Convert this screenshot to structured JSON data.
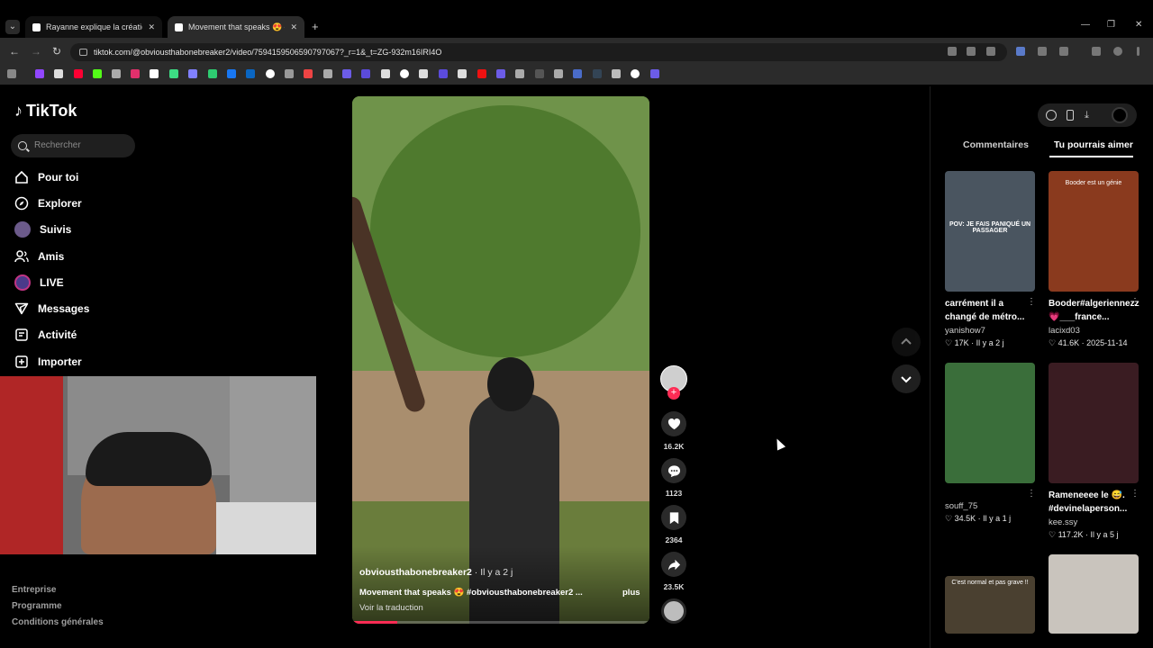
{
  "browser": {
    "tabs": [
      {
        "title": "Rayanne explique la création de",
        "active": false
      },
      {
        "title": "Movement that speaks 😍 #obvi",
        "active": true
      }
    ],
    "url": "tiktok.com/@obviousthabonebreaker2/video/7594159506590797067?_r=1&_t=ZG-932m16IRI4O"
  },
  "sidebar": {
    "brand": "TikTok",
    "search_placeholder": "Rechercher",
    "nav": [
      {
        "label": "Pour toi",
        "icon": "home-icon"
      },
      {
        "label": "Explorer",
        "icon": "compass-icon"
      },
      {
        "label": "Suivis",
        "icon": "following-avatar-icon"
      },
      {
        "label": "Amis",
        "icon": "friends-icon"
      },
      {
        "label": "LIVE",
        "icon": "live-icon"
      },
      {
        "label": "Messages",
        "icon": "messages-icon"
      },
      {
        "label": "Activité",
        "icon": "activity-icon"
      },
      {
        "label": "Importer",
        "icon": "upload-icon"
      }
    ],
    "footer_links": [
      "Entreprise",
      "Programme",
      "Conditions générales"
    ]
  },
  "video": {
    "author": "obviousthabonebreaker2",
    "posted": " · Il y a 2 j",
    "caption": "Movement that speaks 😍 #obviousthabonebreaker2 ...",
    "more": "plus",
    "translate": "Voir la traduction",
    "progress_percent": 15,
    "likes": "16.2K",
    "comments": "1123",
    "saves": "2364",
    "shares": "23.5K"
  },
  "right_panel": {
    "tabs": [
      "Commentaires",
      "Tu pourrais aimer"
    ],
    "active_tab": "Tu pourrais aimer",
    "cards": [
      {
        "overlay": "POV: JE FAIS PANIQUÉ UN PASSAGER",
        "title": "carrément il a changé de métro...",
        "author": "yanishow7",
        "likes": "17K",
        "date": "Il y a 2 j",
        "color": "#4a5560"
      },
      {
        "overlay": "Booder est un génie",
        "title": "Booder#algeriennezz💗___france...",
        "author": "lacixd03",
        "likes": "41.6K",
        "date": "2025-11-14",
        "color": "#8a3a1e"
      },
      {
        "overlay": "",
        "title": "",
        "author": "souff_75",
        "likes": "34.5K",
        "date": "Il y a 1 j",
        "color": "#3a6e3a"
      },
      {
        "overlay": "",
        "title": "Rameneeee le 😅. #devinelaperson...",
        "author": "kee.ssy",
        "likes": "117.2K",
        "date": "Il y a 5 j",
        "color": "#3a1c22"
      },
      {
        "overlay": "C'est normal et pas grave !!",
        "title": "",
        "author": "",
        "likes": "",
        "date": "",
        "color": "#4a4030"
      },
      {
        "overlay": "",
        "title": "",
        "author": "",
        "likes": "",
        "date": "",
        "color": "#c9c4bd"
      }
    ]
  },
  "colors": {
    "accent": "#fe2c55",
    "background": "#000000"
  }
}
